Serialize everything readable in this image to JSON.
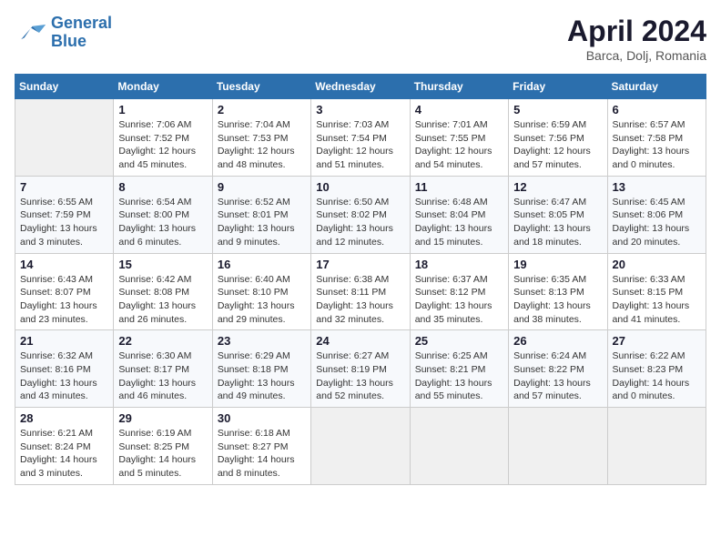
{
  "header": {
    "logo_line1": "General",
    "logo_line2": "Blue",
    "title": "April 2024",
    "location": "Barca, Dolj, Romania"
  },
  "weekdays": [
    "Sunday",
    "Monday",
    "Tuesday",
    "Wednesday",
    "Thursday",
    "Friday",
    "Saturday"
  ],
  "weeks": [
    [
      {
        "day": "",
        "info": ""
      },
      {
        "day": "1",
        "info": "Sunrise: 7:06 AM\nSunset: 7:52 PM\nDaylight: 12 hours\nand 45 minutes."
      },
      {
        "day": "2",
        "info": "Sunrise: 7:04 AM\nSunset: 7:53 PM\nDaylight: 12 hours\nand 48 minutes."
      },
      {
        "day": "3",
        "info": "Sunrise: 7:03 AM\nSunset: 7:54 PM\nDaylight: 12 hours\nand 51 minutes."
      },
      {
        "day": "4",
        "info": "Sunrise: 7:01 AM\nSunset: 7:55 PM\nDaylight: 12 hours\nand 54 minutes."
      },
      {
        "day": "5",
        "info": "Sunrise: 6:59 AM\nSunset: 7:56 PM\nDaylight: 12 hours\nand 57 minutes."
      },
      {
        "day": "6",
        "info": "Sunrise: 6:57 AM\nSunset: 7:58 PM\nDaylight: 13 hours\nand 0 minutes."
      }
    ],
    [
      {
        "day": "7",
        "info": "Sunrise: 6:55 AM\nSunset: 7:59 PM\nDaylight: 13 hours\nand 3 minutes."
      },
      {
        "day": "8",
        "info": "Sunrise: 6:54 AM\nSunset: 8:00 PM\nDaylight: 13 hours\nand 6 minutes."
      },
      {
        "day": "9",
        "info": "Sunrise: 6:52 AM\nSunset: 8:01 PM\nDaylight: 13 hours\nand 9 minutes."
      },
      {
        "day": "10",
        "info": "Sunrise: 6:50 AM\nSunset: 8:02 PM\nDaylight: 13 hours\nand 12 minutes."
      },
      {
        "day": "11",
        "info": "Sunrise: 6:48 AM\nSunset: 8:04 PM\nDaylight: 13 hours\nand 15 minutes."
      },
      {
        "day": "12",
        "info": "Sunrise: 6:47 AM\nSunset: 8:05 PM\nDaylight: 13 hours\nand 18 minutes."
      },
      {
        "day": "13",
        "info": "Sunrise: 6:45 AM\nSunset: 8:06 PM\nDaylight: 13 hours\nand 20 minutes."
      }
    ],
    [
      {
        "day": "14",
        "info": "Sunrise: 6:43 AM\nSunset: 8:07 PM\nDaylight: 13 hours\nand 23 minutes."
      },
      {
        "day": "15",
        "info": "Sunrise: 6:42 AM\nSunset: 8:08 PM\nDaylight: 13 hours\nand 26 minutes."
      },
      {
        "day": "16",
        "info": "Sunrise: 6:40 AM\nSunset: 8:10 PM\nDaylight: 13 hours\nand 29 minutes."
      },
      {
        "day": "17",
        "info": "Sunrise: 6:38 AM\nSunset: 8:11 PM\nDaylight: 13 hours\nand 32 minutes."
      },
      {
        "day": "18",
        "info": "Sunrise: 6:37 AM\nSunset: 8:12 PM\nDaylight: 13 hours\nand 35 minutes."
      },
      {
        "day": "19",
        "info": "Sunrise: 6:35 AM\nSunset: 8:13 PM\nDaylight: 13 hours\nand 38 minutes."
      },
      {
        "day": "20",
        "info": "Sunrise: 6:33 AM\nSunset: 8:15 PM\nDaylight: 13 hours\nand 41 minutes."
      }
    ],
    [
      {
        "day": "21",
        "info": "Sunrise: 6:32 AM\nSunset: 8:16 PM\nDaylight: 13 hours\nand 43 minutes."
      },
      {
        "day": "22",
        "info": "Sunrise: 6:30 AM\nSunset: 8:17 PM\nDaylight: 13 hours\nand 46 minutes."
      },
      {
        "day": "23",
        "info": "Sunrise: 6:29 AM\nSunset: 8:18 PM\nDaylight: 13 hours\nand 49 minutes."
      },
      {
        "day": "24",
        "info": "Sunrise: 6:27 AM\nSunset: 8:19 PM\nDaylight: 13 hours\nand 52 minutes."
      },
      {
        "day": "25",
        "info": "Sunrise: 6:25 AM\nSunset: 8:21 PM\nDaylight: 13 hours\nand 55 minutes."
      },
      {
        "day": "26",
        "info": "Sunrise: 6:24 AM\nSunset: 8:22 PM\nDaylight: 13 hours\nand 57 minutes."
      },
      {
        "day": "27",
        "info": "Sunrise: 6:22 AM\nSunset: 8:23 PM\nDaylight: 14 hours\nand 0 minutes."
      }
    ],
    [
      {
        "day": "28",
        "info": "Sunrise: 6:21 AM\nSunset: 8:24 PM\nDaylight: 14 hours\nand 3 minutes."
      },
      {
        "day": "29",
        "info": "Sunrise: 6:19 AM\nSunset: 8:25 PM\nDaylight: 14 hours\nand 5 minutes."
      },
      {
        "day": "30",
        "info": "Sunrise: 6:18 AM\nSunset: 8:27 PM\nDaylight: 14 hours\nand 8 minutes."
      },
      {
        "day": "",
        "info": ""
      },
      {
        "day": "",
        "info": ""
      },
      {
        "day": "",
        "info": ""
      },
      {
        "day": "",
        "info": ""
      }
    ]
  ]
}
